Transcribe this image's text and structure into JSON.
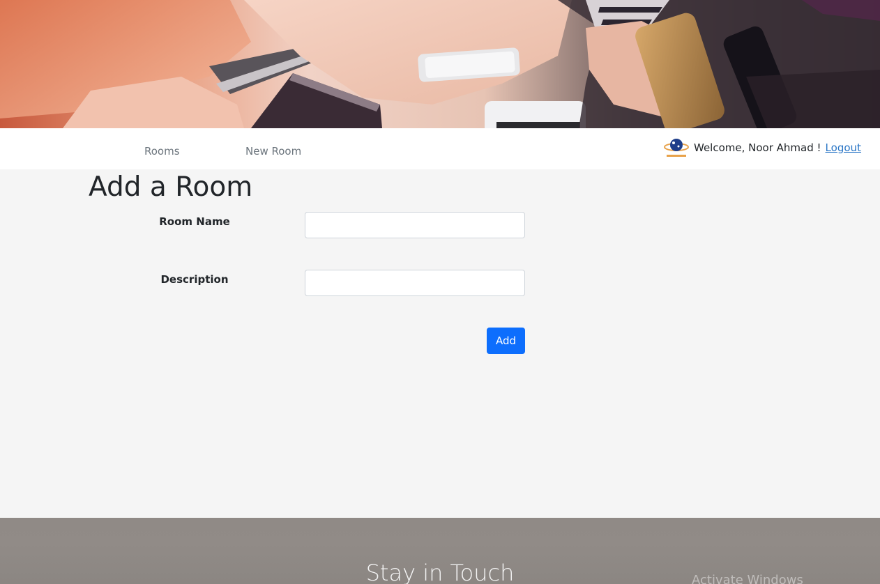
{
  "nav": {
    "rooms_label": "Rooms",
    "new_room_label": "New Room"
  },
  "user": {
    "welcome_text": "Welcome, Noor Ahmad !",
    "logout_label": "Logout",
    "logo_icon": "world-web-logo-icon"
  },
  "form": {
    "title": "Add a Room",
    "room_name_label": "Room Name",
    "room_name_value": "",
    "description_label": "Description",
    "description_value": "",
    "add_label": "Add"
  },
  "footer": {
    "title": "Stay in Touch"
  },
  "os_watermark": "Activate Windows",
  "colors": {
    "primary_button": "#0d6efd",
    "link": "#2a76c6",
    "page_background": "#f5f5f5",
    "footer_background": "#908a86"
  }
}
